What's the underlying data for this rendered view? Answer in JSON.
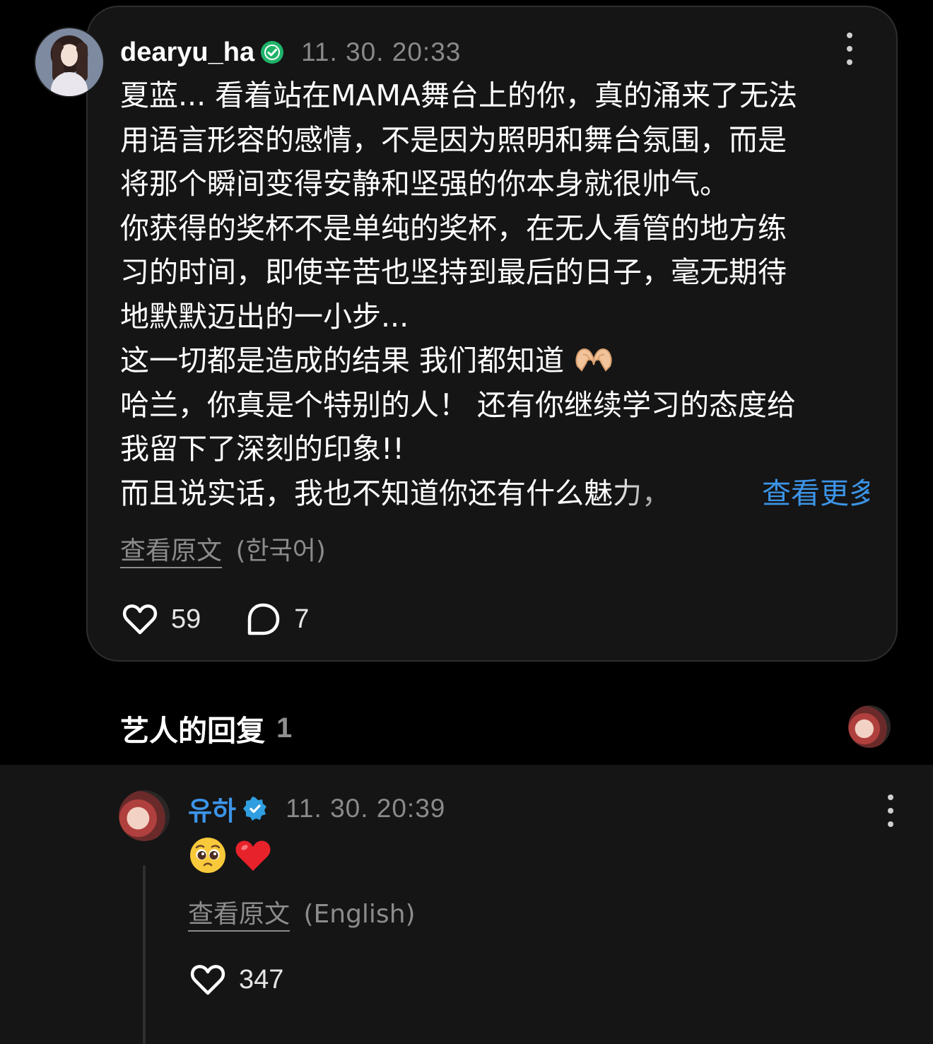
{
  "comment": {
    "username": "dearyu_ha",
    "timestamp": "11. 30. 20:33",
    "lines": [
      "夏蓝... 看着站在MAMA舞台上的你，真的涌来了无法",
      "用语言形容的感情，不是因为照明和舞台氛围，而是",
      "将那个瞬间变得安静和坚强的你本身就很帅气。",
      "你获得的奖杯不是单纯的奖杯，在无人看管的地方练",
      "习的时间，即使辛苦也坚持到最后的日子，毫无期待",
      "地默默迈出的一小步...",
      "这一切都是造成的结果 我们都知道",
      "哈兰，你真是个特别的人！ 还有你继续学习的态度给",
      "我留下了深刻的印象!!",
      "而且说实话，我也不知道你还有什么魅力，"
    ],
    "see_more": "查看更多",
    "translate_link": "查看原文",
    "translate_lang": "(한국어)",
    "likes": "59",
    "replies": "7"
  },
  "artist_replies": {
    "title": "艺人的回复",
    "count": "1"
  },
  "reply": {
    "username": "유하",
    "timestamp": "11. 30. 20:39",
    "emojis": [
      "pleading-face",
      "red-heart"
    ],
    "translate_link": "查看原文",
    "translate_lang": "(English)",
    "likes": "347"
  },
  "icons": {
    "verified_color": "#1fb36a",
    "verified_artist_color": "#2f9ee0",
    "accent_blue": "#3c95e8"
  }
}
